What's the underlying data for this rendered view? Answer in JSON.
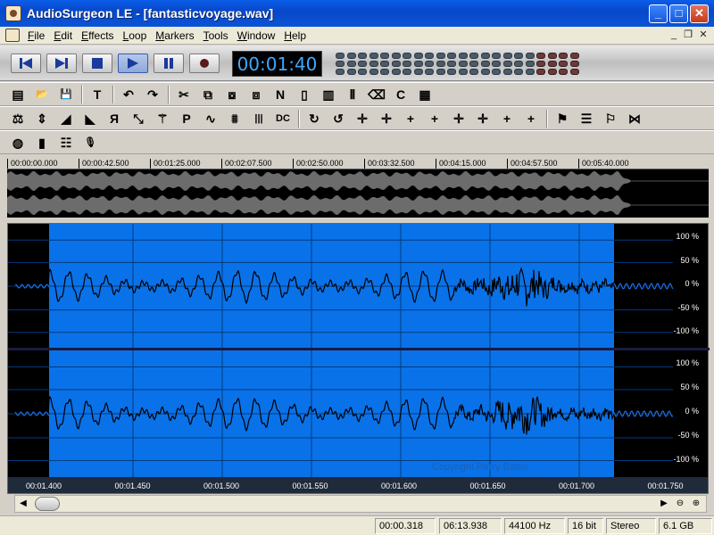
{
  "window": {
    "title": "AudioSurgeon LE - [fantasticvoyage.wav]"
  },
  "menu": [
    "File",
    "Edit",
    "Effects",
    "Loop",
    "Markers",
    "Tools",
    "Window",
    "Help"
  ],
  "transport": {
    "time": "00:01:40",
    "buttons": [
      "prev-icon",
      "next-icon",
      "stop-icon",
      "play-icon",
      "pause-icon",
      "record-icon"
    ]
  },
  "toolbar1": [
    {
      "name": "new-icon",
      "glyph": "▤"
    },
    {
      "name": "open-icon",
      "glyph": "📂"
    },
    {
      "name": "save-icon",
      "glyph": "💾"
    },
    {
      "name": "text-icon",
      "glyph": "T"
    },
    {
      "name": "undo-icon",
      "glyph": "↶"
    },
    {
      "name": "redo-icon",
      "glyph": "↷"
    },
    {
      "name": "cut-icon",
      "glyph": "✂"
    },
    {
      "name": "copy-icon",
      "glyph": "⧉"
    },
    {
      "name": "paste-icon",
      "glyph": "⧇"
    },
    {
      "name": "paste-mix-icon",
      "glyph": "⧈"
    },
    {
      "name": "paste-new-icon",
      "glyph": "N"
    },
    {
      "name": "crop-icon",
      "glyph": "▯"
    },
    {
      "name": "piano-icon",
      "glyph": "▥"
    },
    {
      "name": "split-icon",
      "glyph": "⫴"
    },
    {
      "name": "eraser-icon",
      "glyph": "⌫"
    },
    {
      "name": "c-icon",
      "glyph": "C"
    },
    {
      "name": "join-icon",
      "glyph": "▦"
    }
  ],
  "toolbar2": [
    {
      "name": "balance-icon",
      "glyph": "⚖"
    },
    {
      "name": "amplify-icon",
      "glyph": "⇕"
    },
    {
      "name": "fade-in-icon",
      "glyph": "◢"
    },
    {
      "name": "fade-out-icon",
      "glyph": "◣"
    },
    {
      "name": "reverse-icon",
      "glyph": "Я"
    },
    {
      "name": "normalize-icon",
      "glyph": "⤡"
    },
    {
      "name": "wand-icon",
      "glyph": "⚚"
    },
    {
      "name": "pop-icon",
      "glyph": "P"
    },
    {
      "name": "filter-icon",
      "glyph": "∿"
    },
    {
      "name": "noise-icon",
      "glyph": "⩩"
    },
    {
      "name": "bars-icon",
      "glyph": "|||"
    },
    {
      "name": "dc-icon",
      "glyph": "DC"
    },
    {
      "name": "loop1-icon",
      "glyph": "↻"
    },
    {
      "name": "loop2-icon",
      "glyph": "↺"
    },
    {
      "name": "cross1-icon",
      "glyph": "✛"
    },
    {
      "name": "cross2-icon",
      "glyph": "✛"
    },
    {
      "name": "cross3-icon",
      "glyph": "+"
    },
    {
      "name": "cross4-icon",
      "glyph": "+"
    },
    {
      "name": "cross5-icon",
      "glyph": "✛"
    },
    {
      "name": "cross6-icon",
      "glyph": "✛"
    },
    {
      "name": "cross7-icon",
      "glyph": "+"
    },
    {
      "name": "cross8-icon",
      "glyph": "+"
    },
    {
      "name": "marker-icon",
      "glyph": "⚑"
    },
    {
      "name": "list-icon",
      "glyph": "☰"
    },
    {
      "name": "marker-edit-icon",
      "glyph": "⚐"
    },
    {
      "name": "bowtie-icon",
      "glyph": "⋈"
    }
  ],
  "toolbar3": [
    {
      "name": "globe-icon",
      "glyph": "◍"
    },
    {
      "name": "spectrum-icon",
      "glyph": "▮"
    },
    {
      "name": "eq-icon",
      "glyph": "☷"
    },
    {
      "name": "mic-icon",
      "glyph": "🎙"
    }
  ],
  "overview": {
    "ticks": [
      "00:00:00.000",
      "00:00:42.500",
      "00:01:25.000",
      "00:02:07.500",
      "00:02:50.000",
      "00:03:32.500",
      "00:04:15.000",
      "00:04:57.500",
      "00:05:40.000"
    ]
  },
  "editor": {
    "scale": [
      "100 %",
      "50 %",
      "0 %",
      "-50 %",
      "-100 %"
    ],
    "time_labels": [
      "00:01.400",
      "00:01.450",
      "00:01.500",
      "00:01.550",
      "00:01.600",
      "00:01.650",
      "00:01.700",
      "00:01.750"
    ],
    "copyright": "Copyright Perry Babin"
  },
  "status": {
    "position": "00:00.318",
    "length": "06:13.938",
    "rate": "44100 Hz",
    "bits": "16 bit",
    "channels": "Stereo",
    "free": "6.1 GB"
  },
  "colors": {
    "selection": "#0a72e8",
    "waveform": "#000000",
    "unselected_wave": "#1a6fe0",
    "time_display": "#3ea8ff"
  }
}
